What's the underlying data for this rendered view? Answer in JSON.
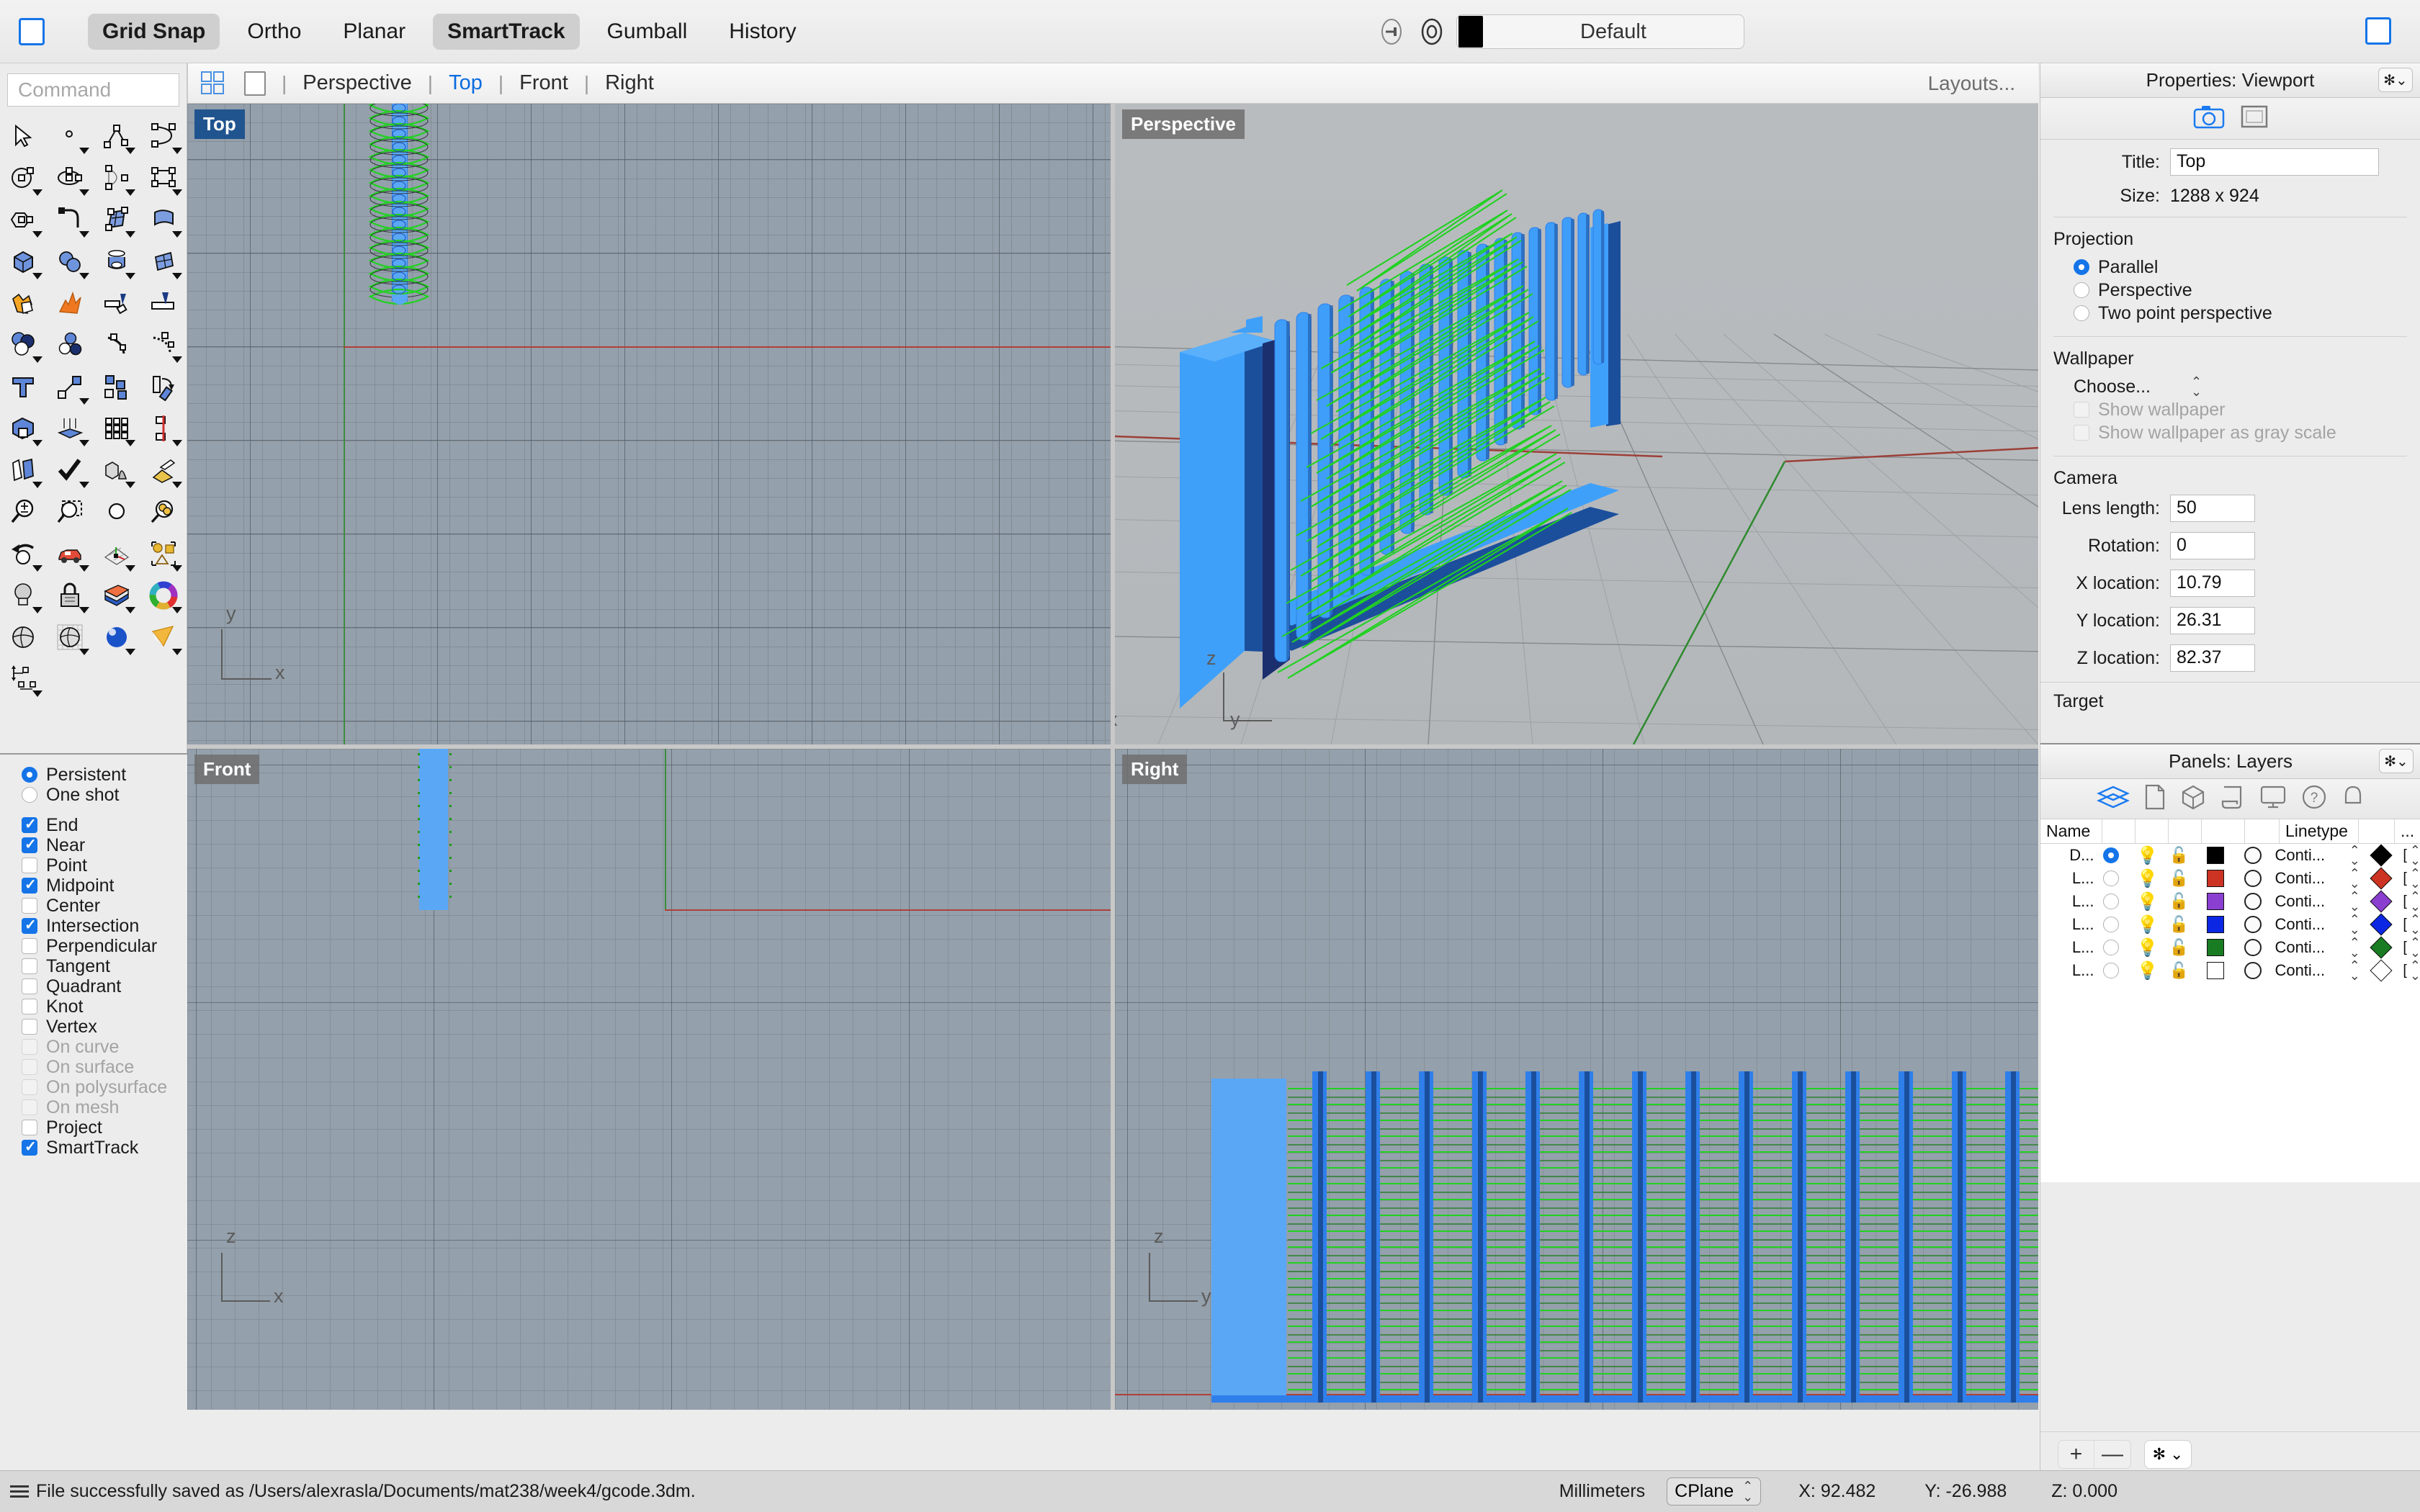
{
  "toolbar": {
    "modes": [
      {
        "label": "Grid Snap",
        "active": true
      },
      {
        "label": "Ortho",
        "active": false
      },
      {
        "label": "Planar",
        "active": false
      },
      {
        "label": "SmartTrack",
        "active": true
      },
      {
        "label": "Gumball",
        "active": false
      },
      {
        "label": "History",
        "active": false
      }
    ],
    "current_layer": "Default",
    "layer_color": "#000000"
  },
  "viewport_tabs": {
    "items": [
      {
        "label": "Perspective",
        "active": false
      },
      {
        "label": "Top",
        "active": true
      },
      {
        "label": "Front",
        "active": false
      },
      {
        "label": "Right",
        "active": false
      }
    ],
    "layouts_label": "Layouts..."
  },
  "command": {
    "placeholder": "Command",
    "value": ""
  },
  "viewports": [
    {
      "name": "Top",
      "active": true,
      "axes": [
        "y",
        "x"
      ]
    },
    {
      "name": "Perspective",
      "active": false,
      "axes": [
        "z",
        "x",
        "y"
      ]
    },
    {
      "name": "Front",
      "active": false,
      "axes": [
        "z",
        "x"
      ]
    },
    {
      "name": "Right",
      "active": false,
      "axes": [
        "z",
        "y"
      ]
    }
  ],
  "osnap": {
    "mode_options": [
      {
        "label": "Persistent",
        "selected": true
      },
      {
        "label": "One shot",
        "selected": false
      }
    ],
    "snaps": [
      {
        "label": "End",
        "checked": true,
        "disabled": false
      },
      {
        "label": "Near",
        "checked": true,
        "disabled": false
      },
      {
        "label": "Point",
        "checked": false,
        "disabled": false
      },
      {
        "label": "Midpoint",
        "checked": true,
        "disabled": false
      },
      {
        "label": "Center",
        "checked": false,
        "disabled": false
      },
      {
        "label": "Intersection",
        "checked": true,
        "disabled": false
      },
      {
        "label": "Perpendicular",
        "checked": false,
        "disabled": false
      },
      {
        "label": "Tangent",
        "checked": false,
        "disabled": false
      },
      {
        "label": "Quadrant",
        "checked": false,
        "disabled": false
      },
      {
        "label": "Knot",
        "checked": false,
        "disabled": false
      },
      {
        "label": "Vertex",
        "checked": false,
        "disabled": false
      },
      {
        "label": "On curve",
        "checked": false,
        "disabled": true
      },
      {
        "label": "On surface",
        "checked": false,
        "disabled": true
      },
      {
        "label": "On polysurface",
        "checked": false,
        "disabled": true
      },
      {
        "label": "On mesh",
        "checked": false,
        "disabled": true
      },
      {
        "label": "Project",
        "checked": false,
        "disabled": false
      },
      {
        "label": "SmartTrack",
        "checked": true,
        "disabled": false
      }
    ]
  },
  "properties": {
    "panel_title": "Properties: Viewport",
    "title_label": "Title:",
    "title_value": "Top",
    "size_label": "Size:",
    "size_value": "1288 x 924",
    "projection_header": "Projection",
    "projection_options": [
      {
        "label": "Parallel",
        "selected": true
      },
      {
        "label": "Perspective",
        "selected": false
      },
      {
        "label": "Two point perspective",
        "selected": false
      }
    ],
    "wallpaper_header": "Wallpaper",
    "wallpaper_choose": "Choose...",
    "wallpaper_checks": [
      {
        "label": "Show wallpaper",
        "checked": false,
        "disabled": true
      },
      {
        "label": "Show wallpaper as gray scale",
        "checked": false,
        "disabled": true
      }
    ],
    "camera_header": "Camera",
    "camera_fields": [
      {
        "label": "Lens length:",
        "value": "50"
      },
      {
        "label": "Rotation:",
        "value": "0"
      },
      {
        "label": "X location:",
        "value": "10.79"
      },
      {
        "label": "Y location:",
        "value": "26.31"
      },
      {
        "label": "Z location:",
        "value": "82.37"
      }
    ],
    "target_header": "Target"
  },
  "layers": {
    "panel_title": "Panels: Layers",
    "columns": [
      "Name",
      "",
      "",
      "",
      "",
      "",
      "Linetype",
      "",
      "..."
    ],
    "rows": [
      {
        "name": "D...",
        "current": true,
        "on": true,
        "locked": false,
        "color": "#000000",
        "linetype": "Conti...",
        "print_color": "#000000"
      },
      {
        "name": "L...",
        "current": false,
        "on": true,
        "locked": false,
        "color": "#cc3322",
        "linetype": "Conti...",
        "print_color": "#cc3322"
      },
      {
        "name": "L...",
        "current": false,
        "on": true,
        "locked": false,
        "color": "#8a3fd0",
        "linetype": "Conti...",
        "print_color": "#8a3fd0"
      },
      {
        "name": "L...",
        "current": false,
        "on": true,
        "locked": false,
        "color": "#0b27e3",
        "linetype": "Conti...",
        "print_color": "#0b27e3"
      },
      {
        "name": "L...",
        "current": false,
        "on": true,
        "locked": false,
        "color": "#197c22",
        "linetype": "Conti...",
        "print_color": "#197c22"
      },
      {
        "name": "L...",
        "current": false,
        "on": true,
        "locked": false,
        "color": "#ffffff",
        "linetype": "Conti...",
        "print_color": "#ffffff"
      }
    ],
    "add_button": "+",
    "remove_button": "—"
  },
  "status": {
    "message": "File successfully saved as /Users/alexrasla/Documents/mat238/week4/gcode.3dm.",
    "units": "Millimeters",
    "cplane": "CPlane",
    "x": "X: 92.482",
    "y": "Y: -26.988",
    "z": "Z: 0.000"
  }
}
